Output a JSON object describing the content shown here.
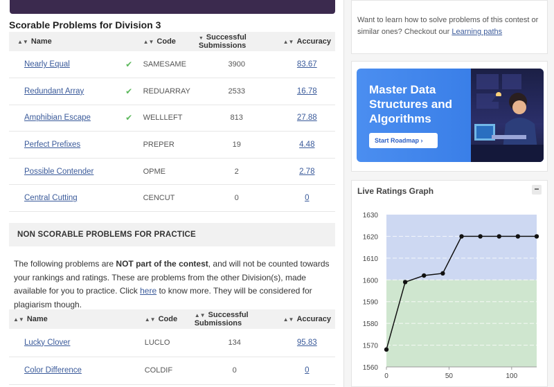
{
  "scorable": {
    "title": "Scorable Problems for Division 3",
    "headers": {
      "name": "Name",
      "code": "Code",
      "subs": "Successful Submissions",
      "acc": "Accuracy"
    },
    "rows": [
      {
        "name": "Nearly Equal",
        "solved": true,
        "code": "SAMESAME",
        "subs": "3900",
        "acc": "83.67"
      },
      {
        "name": "Redundant Array",
        "solved": true,
        "code": "REDUARRAY",
        "subs": "2533",
        "acc": "16.78"
      },
      {
        "name": "Amphibian Escape",
        "solved": true,
        "code": "WELLLEFT",
        "subs": "813",
        "acc": "27.88"
      },
      {
        "name": "Perfect Prefixes",
        "solved": false,
        "code": "PREPER",
        "subs": "19",
        "acc": "4.48"
      },
      {
        "name": "Possible Contender",
        "solved": false,
        "code": "OPME",
        "subs": "2",
        "acc": "2.78"
      },
      {
        "name": "Central Cutting",
        "solved": false,
        "code": "CENCUT",
        "subs": "0",
        "acc": "0"
      }
    ]
  },
  "nonscorable": {
    "title": "NON SCORABLE PROBLEMS FOR PRACTICE",
    "text_1": "The following problems are ",
    "text_bold": "NOT part of the contest",
    "text_2": ", and will not be counted towards your rankings and ratings. These are problems from the other Division(s), made available for you to practice. Click ",
    "link": "here",
    "text_3": " to know more. They will be considered for plagiarism though.",
    "headers": {
      "name": "Name",
      "code": "Code",
      "subs": "Successful Submissions",
      "acc": "Accuracy"
    },
    "rows": [
      {
        "name": "Lucky Clover",
        "code": "LUCLO",
        "subs": "134",
        "acc": "95.83"
      },
      {
        "name": "Color Difference",
        "code": "COLDIF",
        "subs": "0",
        "acc": "0"
      }
    ]
  },
  "learn": {
    "text": "Want to learn how to solve problems of this contest or similar ones? Checkout our ",
    "link": "Learning paths"
  },
  "promo": {
    "title": "Master Data Structures and Algorithms",
    "button": "Start Roadmap",
    "button_icon": "chevron-right-icon"
  },
  "graph": {
    "title": "Live Ratings Graph",
    "collapse_icon": "minus-icon"
  },
  "chart_data": {
    "type": "line",
    "title": "Live Ratings Graph",
    "x": [
      0,
      15,
      30,
      45,
      60,
      75,
      90,
      105,
      120
    ],
    "values": [
      1568,
      1599,
      1602,
      1603,
      1620,
      1620,
      1620,
      1620,
      1620
    ],
    "xlim": [
      0,
      120
    ],
    "ylim": [
      1560,
      1630
    ],
    "xticks": [
      0,
      50,
      100
    ],
    "yticks": [
      1560,
      1570,
      1580,
      1590,
      1600,
      1610,
      1620,
      1630
    ],
    "bands": [
      {
        "from": 1560,
        "to": 1600,
        "color": "#cfe6cf"
      },
      {
        "from": 1600,
        "to": 1630,
        "color": "#cdd8f2"
      }
    ],
    "grid": true,
    "line_color": "#111111"
  }
}
